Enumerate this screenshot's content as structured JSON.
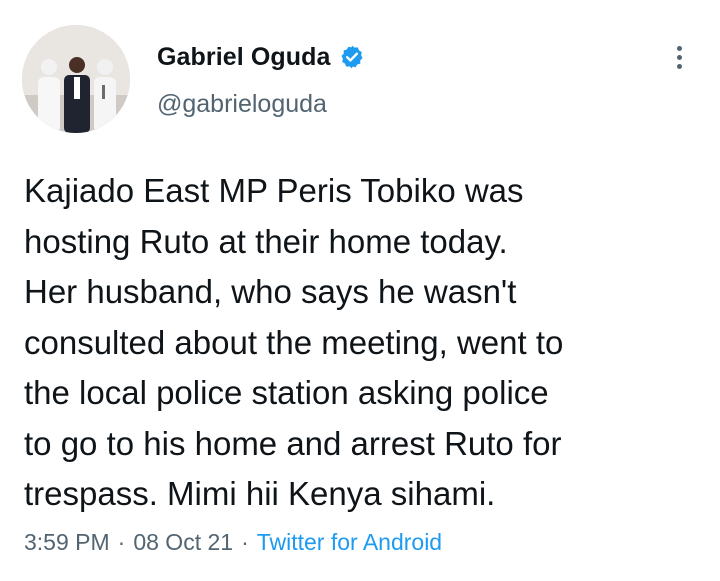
{
  "author": {
    "display_name": "Gabriel Oguda",
    "handle": "@gabrieloguda",
    "verified": true,
    "avatar_icon": "profile-photo"
  },
  "tweet": {
    "text": "Kajiado East MP Peris Tobiko was\nhosting Ruto at their home today.\nHer husband, who says he wasn't\nconsulted about the meeting, went to\nthe local police station asking police\nto go to his home and arrest Ruto for\ntrespass. Mimi hii Kenya sihami.",
    "time": "3:59 PM",
    "date": "08 Oct 21",
    "source": "Twitter for Android",
    "separator": "·"
  },
  "icons": {
    "verified": "verified-badge-icon",
    "more": "more-options-icon"
  },
  "colors": {
    "text": "#0f1419",
    "secondary": "#536471",
    "accent": "#1d9bf0"
  }
}
